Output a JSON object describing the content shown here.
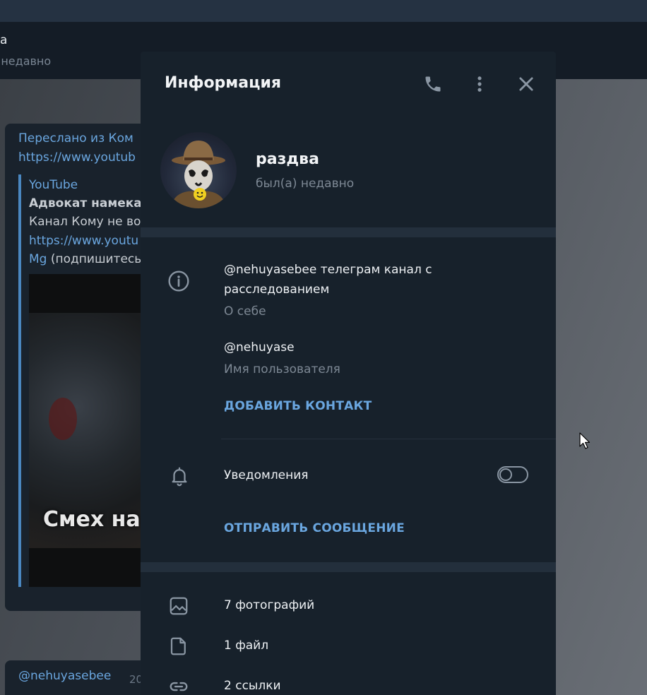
{
  "chat": {
    "header_name": "ва",
    "header_status": ") недавно",
    "message": {
      "forwarded_from": "Переслано из Ком",
      "link": "https://www.youtub",
      "preview_site": "YouTube",
      "preview_title": "Адвокат намека",
      "preview_desc": "Канал Кому не во",
      "preview_link": "https://www.youtu",
      "preview_link_end": "Mg",
      "preview_desc_end": " (подпишитесь",
      "thumbnail_caption": "Смех на"
    },
    "message2": {
      "username": "@nehuyasebee",
      "date": "20"
    }
  },
  "panel": {
    "title": "Информация",
    "name": "раздва",
    "status": "был(а) недавно",
    "bio": {
      "line1": "@nehuyasebee телеграм канал с",
      "line2": "расследованием",
      "label": "О себе"
    },
    "username": {
      "value": "@nehuyase",
      "label": "Имя пользователя"
    },
    "add_contact": "ДОБАВИТЬ КОНТАКТ",
    "notifications": {
      "label": "Уведомления",
      "enabled": false
    },
    "send_message": "ОТПРАВИТЬ СООБЩЕНИЕ",
    "media": {
      "photos": "7 фотографий",
      "files": "1 файл",
      "links": "2 ссылки"
    }
  },
  "colors": {
    "accent": "#6aa6df",
    "panel_bg": "#17212b",
    "separator": "#232f3c"
  }
}
